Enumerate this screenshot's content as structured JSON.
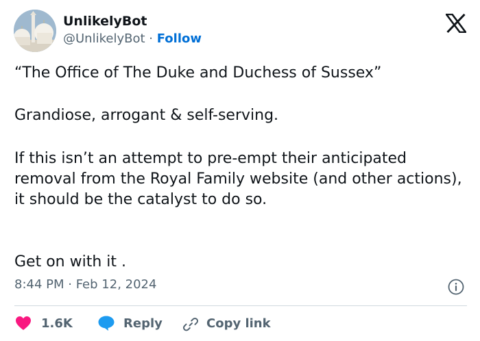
{
  "author": {
    "display_name": "UnlikelyBot",
    "handle": "@UnlikelyBot",
    "separator": "·",
    "follow_label": "Follow"
  },
  "tweet": {
    "paragraphs": [
      "“The Office of The Duke and Duchess of Sussex”",
      "Grandiose, arrogant & self-serving.",
      "If this isn’t an attempt to pre-empt their anticipated removal from the Royal Family website (and other actions), it should be the catalyst to do so.",
      "Get on with it ."
    ],
    "timestamp": "8:44 PM · Feb 12, 2024"
  },
  "actions": {
    "likes_count": "1.6K",
    "reply_label": "Reply",
    "copy_link_label": "Copy link"
  },
  "icons": {
    "brand": "x-logo-icon",
    "info": "info-icon",
    "like": "heart-icon",
    "reply": "speech-bubble-icon",
    "copy": "link-icon"
  },
  "colors": {
    "text": "#0f1419",
    "muted": "#536471",
    "follow": "#006fd6",
    "heart": "#f91880",
    "reply_bubble": "#1d9bf0",
    "divider": "#cfd9de"
  }
}
